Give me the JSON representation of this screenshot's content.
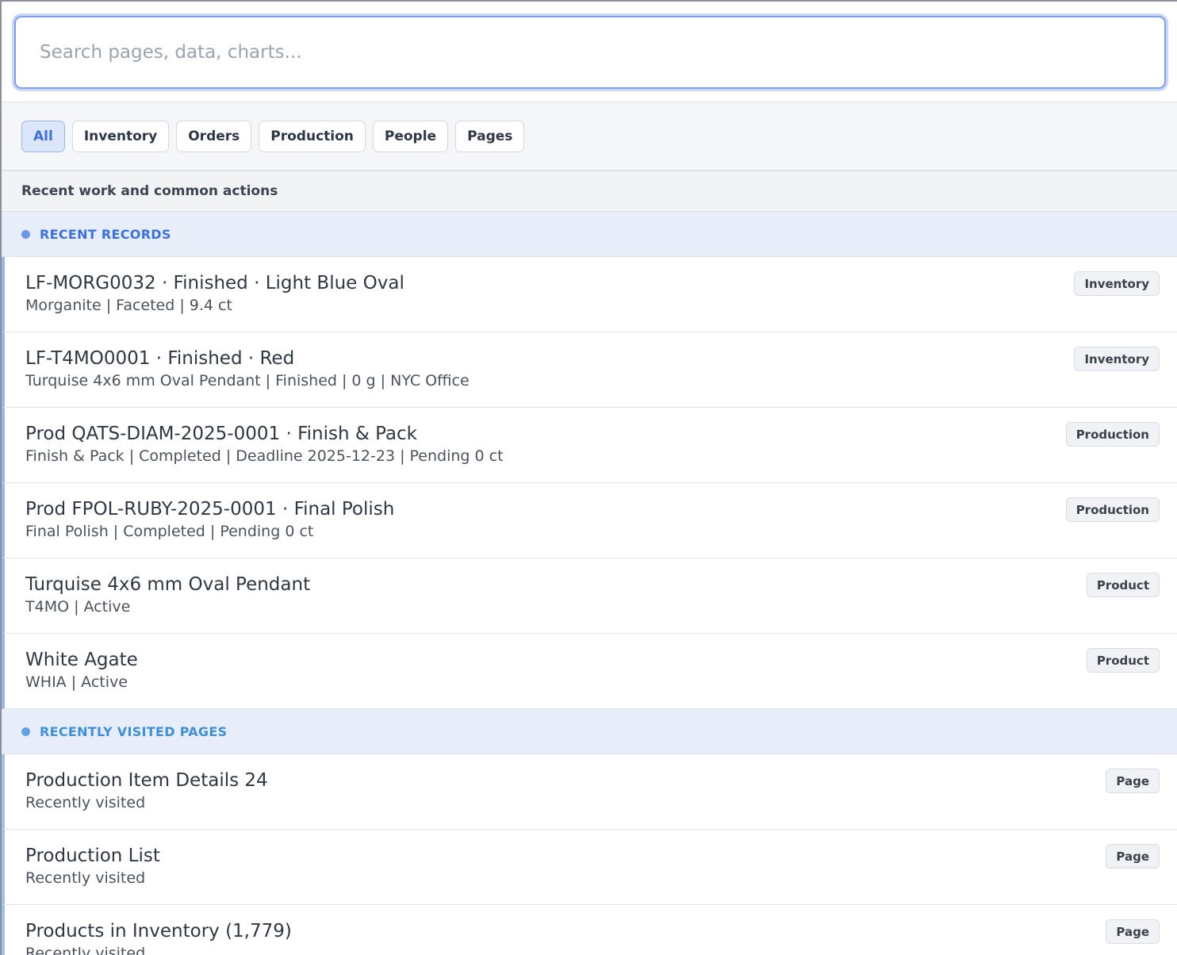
{
  "search": {
    "placeholder": "Search pages, data, charts..."
  },
  "filters": [
    {
      "label": "All",
      "active": true
    },
    {
      "label": "Inventory"
    },
    {
      "label": "Orders"
    },
    {
      "label": "Production"
    },
    {
      "label": "People"
    },
    {
      "label": "Pages"
    }
  ],
  "hint": "Recent work and common actions",
  "colors": {
    "accent": "#3c70e0",
    "pages_accent": "#3f8fd8"
  },
  "sections": {
    "records": {
      "title": "RECENT RECORDS",
      "items": [
        {
          "title": "LF-MORG0032 · Finished · Light Blue Oval",
          "subtitle": "Morganite | Faceted | 9.4 ct",
          "badge": "Inventory"
        },
        {
          "title": "LF-T4MO0001 · Finished · Red",
          "subtitle": "Turquise 4x6 mm Oval Pendant | Finished | 0 g | NYC Office",
          "badge": "Inventory"
        },
        {
          "title": "Prod QATS-DIAM-2025-0001 · Finish & Pack",
          "subtitle": "Finish & Pack | Completed | Deadline 2025-12-23 | Pending 0 ct",
          "badge": "Production"
        },
        {
          "title": "Prod FPOL-RUBY-2025-0001 · Final Polish",
          "subtitle": "Final Polish | Completed | Pending 0 ct",
          "badge": "Production"
        },
        {
          "title": "Turquise 4x6 mm Oval Pendant",
          "subtitle": "T4MO | Active",
          "badge": "Product"
        },
        {
          "title": "White Agate",
          "subtitle": "WHIA | Active",
          "badge": "Product"
        }
      ]
    },
    "pages": {
      "title": "RECENTLY VISITED PAGES",
      "items": [
        {
          "title": "Production Item Details 24",
          "subtitle": "Recently visited",
          "badge": "Page"
        },
        {
          "title": "Production List",
          "subtitle": "Recently visited",
          "badge": "Page"
        },
        {
          "title": "Products in Inventory (1,779)",
          "subtitle": "Recently visited",
          "badge": "Page"
        }
      ]
    }
  }
}
